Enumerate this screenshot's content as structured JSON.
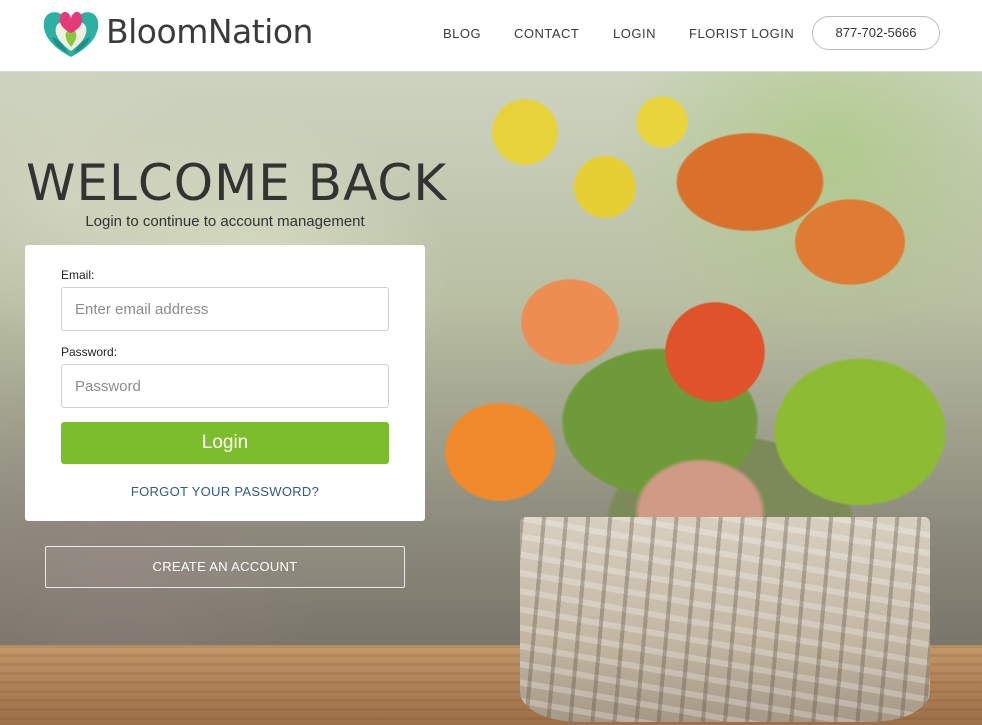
{
  "header": {
    "brand": "BloomNation",
    "nav": [
      "BLOG",
      "CONTACT",
      "LOGIN",
      "FLORIST LOGIN"
    ],
    "phone": "877-702-5666"
  },
  "welcome": {
    "title": "WELCOME BACK",
    "subtitle": "Login to continue to account management"
  },
  "login_form": {
    "email_label": "Email:",
    "email_placeholder": "Enter email address",
    "password_label": "Password:",
    "password_placeholder": "Password",
    "login_label": "Login",
    "forgot_label": "FORGOT YOUR PASSWORD?"
  },
  "create_account_label": "CREATE AN ACCOUNT",
  "colors": {
    "accent_green": "#7bbd2a",
    "link_blue": "#2f5a87"
  },
  "icons": {
    "logo": "heart-flower-logo-icon"
  }
}
